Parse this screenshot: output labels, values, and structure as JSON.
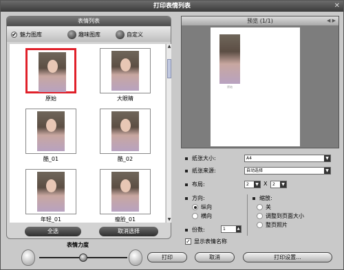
{
  "window": {
    "title": "打印表情列表",
    "close": "✕"
  },
  "left_panel": {
    "header": "表情列表",
    "sources": [
      {
        "label": "魅力图库",
        "selected": true
      },
      {
        "label": "趣味图库",
        "selected": false
      },
      {
        "label": "自定义",
        "selected": false
      }
    ],
    "thumbnails": [
      {
        "caption": "原始",
        "selected": true
      },
      {
        "caption": "大眼睛",
        "selected": false
      },
      {
        "caption": "酷_01",
        "selected": false
      },
      {
        "caption": "酷_02",
        "selected": false
      },
      {
        "caption": "年轻_01",
        "selected": false
      },
      {
        "caption": "瘦脸_01",
        "selected": false
      }
    ],
    "select_all": "全选",
    "deselect": "取消选择",
    "strength_label": "表情力度",
    "strength_value": 0.55
  },
  "preview": {
    "title": "预览 (1/1)",
    "nav": "◀ ▶"
  },
  "options": {
    "paper_size_label": "纸张大小:",
    "paper_size_value": "A4",
    "paper_source_label": "纸张来源:",
    "paper_source_value": "自动选择",
    "layout_label": "布局:",
    "layout_rows": "2",
    "layout_x": "X",
    "layout_cols": "2",
    "orientation_label": "方向:",
    "orientation_options": [
      "纵向",
      "横向"
    ],
    "orientation_selected": 0,
    "scale_label": "缩放:",
    "scale_options": [
      "关",
      "调整到页面大小",
      "整页照片"
    ],
    "copies_label": "份数:",
    "copies_value": "1",
    "show_name_label": "显示表情名称",
    "show_name_checked": true
  },
  "buttons": {
    "print": "打印",
    "cancel": "取消",
    "print_settings": "打印设置..."
  }
}
